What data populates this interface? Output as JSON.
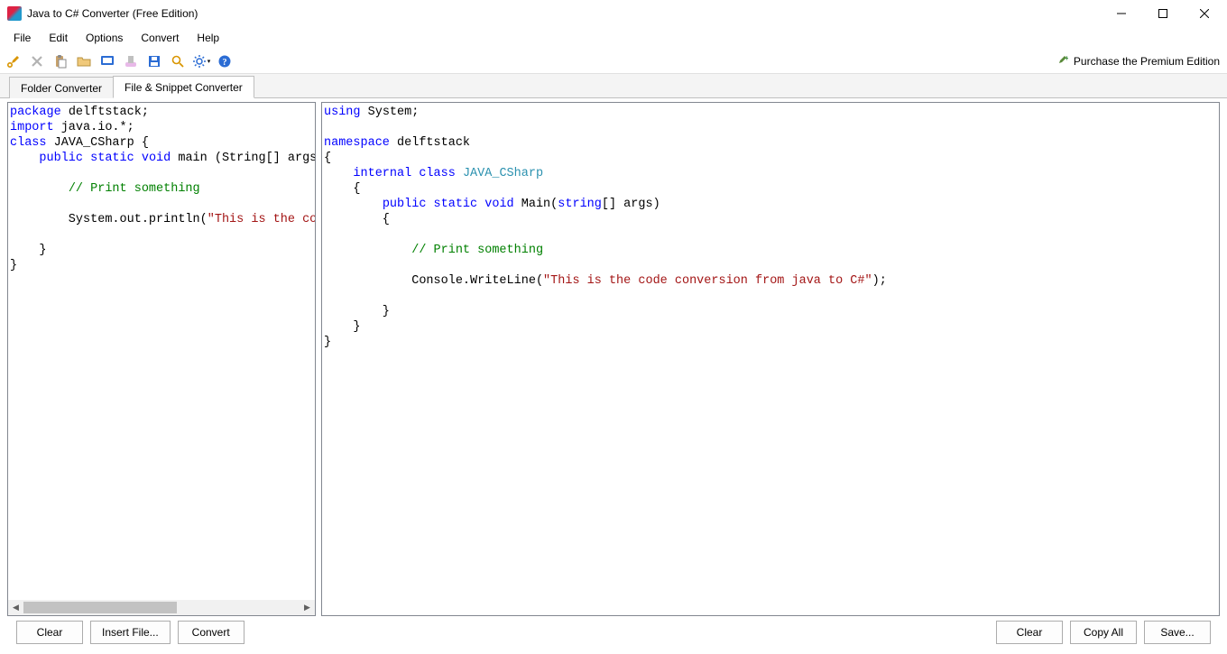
{
  "window": {
    "title": "Java to C# Converter (Free Edition)",
    "premium_link": "Purchase the Premium Edition"
  },
  "menus": {
    "file": "File",
    "edit": "Edit",
    "options": "Options",
    "convert": "Convert",
    "help": "Help"
  },
  "tabs": {
    "folder": "Folder Converter",
    "file_snippet": "File & Snippet Converter"
  },
  "buttons": {
    "left_clear": "Clear",
    "insert_file": "Insert File...",
    "convert": "Convert",
    "right_clear": "Clear",
    "copy_all": "Copy All",
    "save": "Save..."
  },
  "code": {
    "java": {
      "l1_kw": "package",
      "l1_rest": " delftstack;",
      "l2_kw": "import",
      "l2_rest": " java.io.*;",
      "l3_kw": "class",
      "l3_rest": " JAVA_CSharp {",
      "l4_pre": "    ",
      "l4_kw1": "public",
      "l4_sp1": " ",
      "l4_kw2": "static",
      "l4_sp2": " ",
      "l4_kw3": "void",
      "l4_rest": " main (String[] args",
      "l6_pre": "        ",
      "l6_cmt": "// Print something",
      "l8_pre": "        System.out.println(",
      "l8_str": "\"This is the co",
      "l10": "    }",
      "l11": "}"
    },
    "cs": {
      "l1_kw": "using",
      "l1_rest": " System;",
      "l3_kw": "namespace",
      "l3_rest": " delftstack",
      "l4": "{",
      "l5_pre": "    ",
      "l5_kw1": "internal",
      "l5_sp1": " ",
      "l5_kw2": "class",
      "l5_sp2": " ",
      "l5_cls": "JAVA_CSharp",
      "l6": "    {",
      "l7_pre": "        ",
      "l7_kw1": "public",
      "l7_sp1": " ",
      "l7_kw2": "static",
      "l7_sp2": " ",
      "l7_kw3": "void",
      "l7_rest1": " Main(",
      "l7_kw4": "string",
      "l7_rest2": "[] args)",
      "l8": "        {",
      "l10_pre": "            ",
      "l10_cmt": "// Print something",
      "l12_pre": "            Console.WriteLine(",
      "l12_str": "\"This is the code conversion from java to C#\"",
      "l12_rest": ");",
      "l14": "        }",
      "l15": "    }",
      "l16": "}"
    }
  }
}
